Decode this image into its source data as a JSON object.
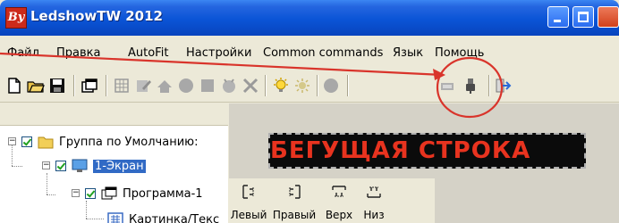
{
  "window": {
    "app_icon_text": "By",
    "title": "LedshowTW 2012"
  },
  "menu": [
    "Файл",
    "Правка",
    "AutoFit",
    "Настройки",
    "Common commands",
    "Язык",
    "Помощь"
  ],
  "toolbar": {
    "buttons": [
      "new-file-icon",
      "open-folder-icon",
      "save-icon",
      "windows-icon",
      "grid-icon",
      "edit-icon",
      "brightness-icon",
      "circle-icon",
      "square-icon",
      "timer-icon",
      "delete-icon",
      "light-bulb-icon",
      "sun-icon",
      "disk-icon",
      "display-icon",
      "usb-plug-icon",
      "exit-icon"
    ]
  },
  "tree": {
    "items": [
      {
        "label": "Группа по Умолчанию:",
        "icon": "folder-icon"
      },
      {
        "label": "1-Экран",
        "icon": "monitor-icon",
        "selected": true
      },
      {
        "label": "Программа-1",
        "icon": "program-window-icon"
      },
      {
        "label": "Картинка/Текс",
        "icon": "image-text-icon"
      }
    ]
  },
  "led": {
    "text": "БЕГУЩАЯ СТРОКА",
    "text_color": "#e8331f",
    "background": "#0b0b0b"
  },
  "alignment": {
    "buttons": [
      {
        "label": "Левый",
        "icon": "align-left-icon"
      },
      {
        "label": "Правый",
        "icon": "align-right-icon"
      },
      {
        "label": "Верх",
        "icon": "align-top-icon"
      },
      {
        "label": "Низ",
        "icon": "align-bottom-icon"
      }
    ]
  },
  "annotation": {
    "color": "#d9342b"
  }
}
